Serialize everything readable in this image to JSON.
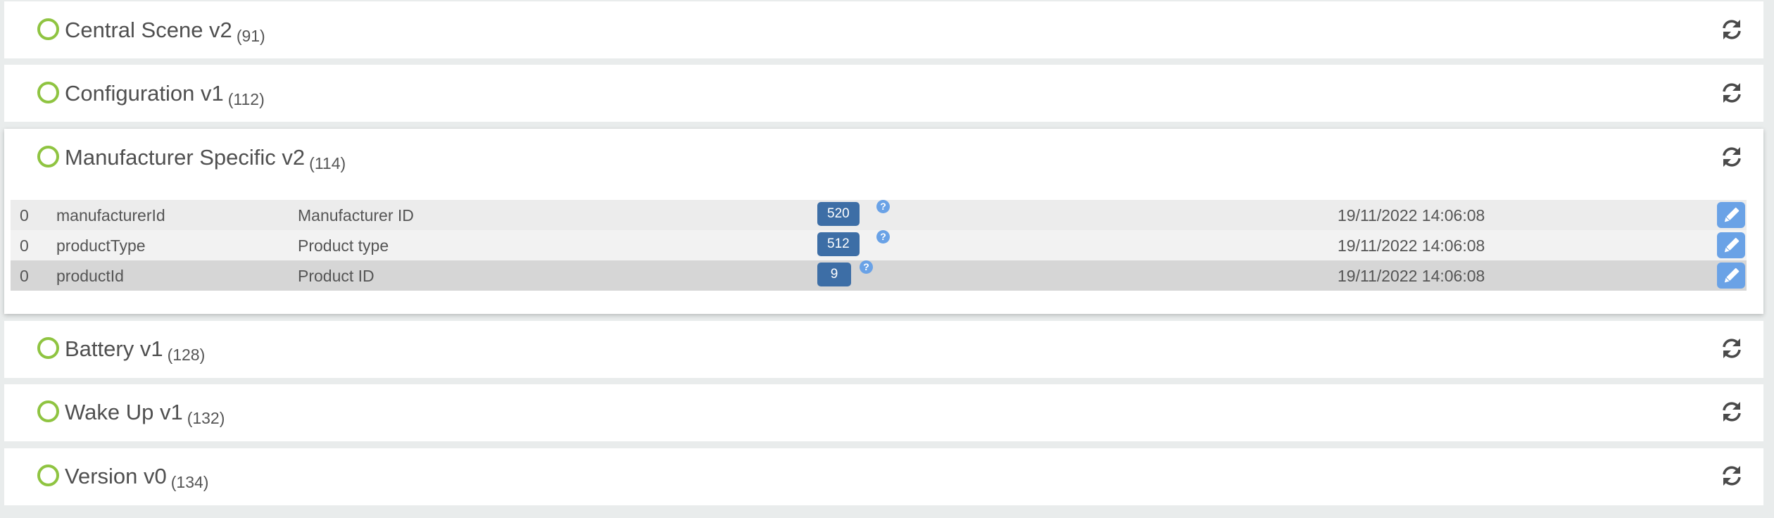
{
  "accent": {
    "status_ring": "#8fc441",
    "value_badge": "#3d6ea6",
    "action_button": "#6aa2e6"
  },
  "command_classes": [
    {
      "name": "Central Scene v2",
      "id": "(91)",
      "status_icon": "status-ring-icon",
      "action_icon": "refresh-icon"
    },
    {
      "name": "Configuration v1",
      "id": "(112)",
      "status_icon": "status-ring-icon",
      "action_icon": "refresh-icon"
    },
    {
      "name": "Manufacturer Specific v2",
      "id": "(114)",
      "status_icon": "status-ring-icon",
      "action_icon": "refresh-icon",
      "rows": [
        {
          "instance": "0",
          "name": "manufacturerId",
          "label": "Manufacturer ID",
          "value": "520",
          "help": "?",
          "updated": "19/11/2022 14:06:08",
          "edit_icon": "pencil-icon"
        },
        {
          "instance": "0",
          "name": "productType",
          "label": "Product type",
          "value": "512",
          "help": "?",
          "updated": "19/11/2022 14:06:08",
          "edit_icon": "pencil-icon"
        },
        {
          "instance": "0",
          "name": "productId",
          "label": "Product ID",
          "value": "9",
          "help": "?",
          "updated": "19/11/2022 14:06:08",
          "edit_icon": "pencil-icon"
        }
      ]
    },
    {
      "name": "Battery v1",
      "id": "(128)",
      "status_icon": "status-ring-icon",
      "action_icon": "refresh-icon"
    },
    {
      "name": "Wake Up v1",
      "id": "(132)",
      "status_icon": "status-ring-icon",
      "action_icon": "refresh-icon"
    },
    {
      "name": "Version v0",
      "id": "(134)",
      "status_icon": "status-ring-icon",
      "action_icon": "refresh-icon"
    }
  ]
}
